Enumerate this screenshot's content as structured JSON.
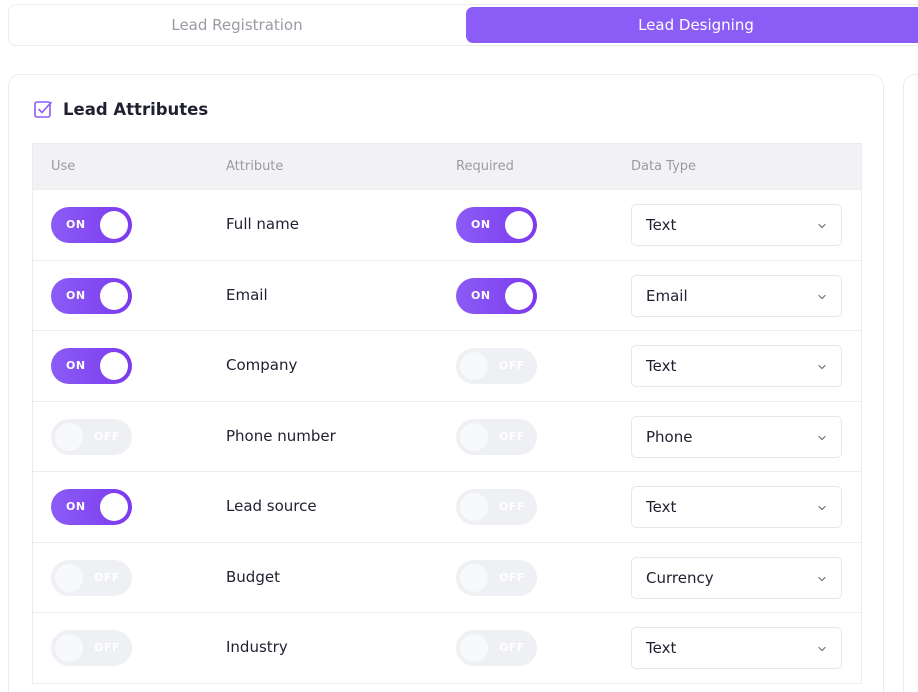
{
  "tabs": [
    {
      "label": "Lead Registration",
      "active": false
    },
    {
      "label": "Lead Designing",
      "active": true
    }
  ],
  "section": {
    "title": "Lead Attributes",
    "icon": "checkbox-checked-icon"
  },
  "table": {
    "headers": {
      "use": "Use",
      "attribute": "Attribute",
      "required": "Required",
      "data_type": "Data Type"
    },
    "rows": [
      {
        "use": "ON",
        "attribute": "Full name",
        "required": "ON",
        "data_type": "Text"
      },
      {
        "use": "ON",
        "attribute": "Email",
        "required": "ON",
        "data_type": "Email"
      },
      {
        "use": "ON",
        "attribute": "Company",
        "required": "OFF",
        "data_type": "Text"
      },
      {
        "use": "OFF",
        "attribute": "Phone number",
        "required": "OFF",
        "data_type": "Phone"
      },
      {
        "use": "ON",
        "attribute": "Lead source",
        "required": "OFF",
        "data_type": "Text"
      },
      {
        "use": "OFF",
        "attribute": "Budget",
        "required": "OFF",
        "data_type": "Currency"
      },
      {
        "use": "OFF",
        "attribute": "Industry",
        "required": "OFF",
        "data_type": "Text"
      }
    ]
  },
  "colors": {
    "accent": "#8b5cf6",
    "toggle_off": "#eef0f4",
    "header_bg": "#f2f2f5"
  }
}
